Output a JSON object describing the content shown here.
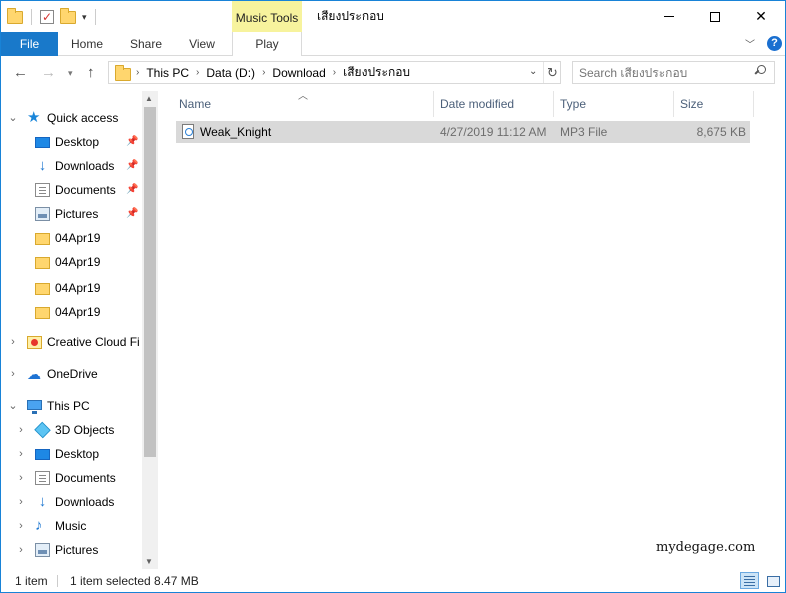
{
  "window": {
    "title": "เสียงประกอบ",
    "contextual_tab_group": "Music Tools"
  },
  "ribbon": {
    "tabs": [
      "File",
      "Home",
      "Share",
      "View",
      "Play"
    ]
  },
  "address": {
    "crumbs": [
      "This PC",
      "Data (D:)",
      "Download",
      "เสียงประกอบ"
    ]
  },
  "search": {
    "placeholder": "Search เสียงประกอบ"
  },
  "navpane": {
    "quick_access": "Quick access",
    "qa_items": [
      "Desktop",
      "Downloads",
      "Documents",
      "Pictures",
      "04Apr19",
      "04Apr19",
      "04Apr19",
      "04Apr19"
    ],
    "creative_cloud": "Creative Cloud Fil",
    "onedrive": "OneDrive",
    "this_pc": "This PC",
    "pc_items": [
      "3D Objects",
      "Desktop",
      "Documents",
      "Downloads",
      "Music",
      "Pictures"
    ]
  },
  "columns": {
    "name": "Name",
    "date": "Date modified",
    "type": "Type",
    "size": "Size"
  },
  "files": [
    {
      "name": "Weak_Knight",
      "date": "4/27/2019 11:12 AM",
      "type": "MP3 File",
      "size": "8,675 KB"
    }
  ],
  "status": {
    "count": "1 item",
    "selected": "1 item selected  8.47 MB"
  },
  "watermark": "mydegage.com",
  "colors": {
    "file_tab": "#1979ca",
    "music_tools": "#f7f39d",
    "selection": "#d9d9d9"
  }
}
